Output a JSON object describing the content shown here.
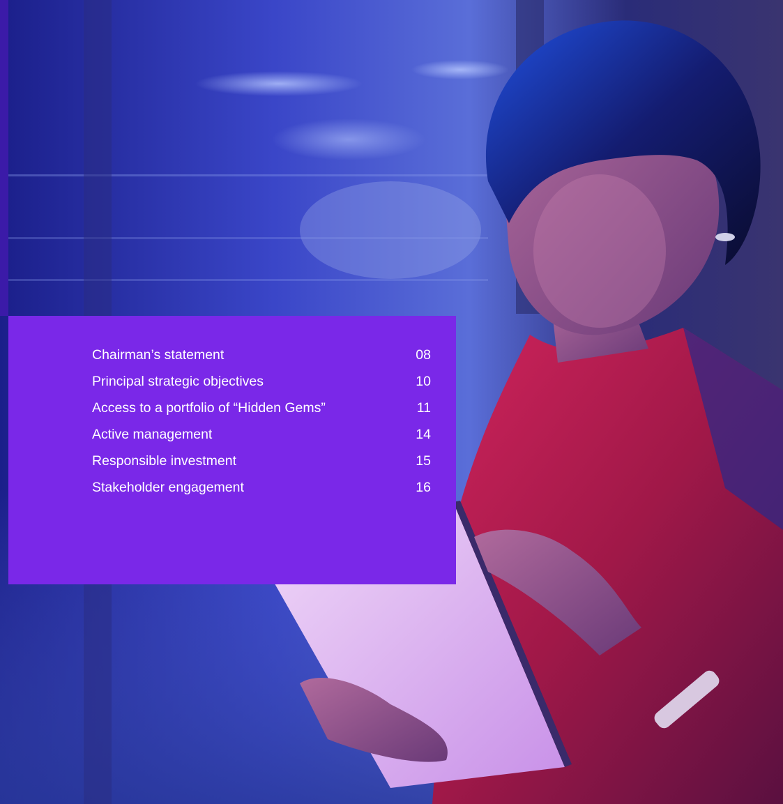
{
  "theme": {
    "panel_color": "#7a28e8",
    "text_color": "#ffffff"
  },
  "background_photo": {
    "icon": "photo-woman-using-tablet"
  },
  "contents": [
    {
      "title": "Chairman’s statement",
      "page": "08"
    },
    {
      "title": "Principal strategic objectives",
      "page": "10"
    },
    {
      "title": "Access to a portfolio of  “Hidden Gems”",
      "page": "11"
    },
    {
      "title": "Active management",
      "page": "14"
    },
    {
      "title": "Responsible investment",
      "page": "15"
    },
    {
      "title": "Stakeholder engagement",
      "page": "16"
    }
  ]
}
